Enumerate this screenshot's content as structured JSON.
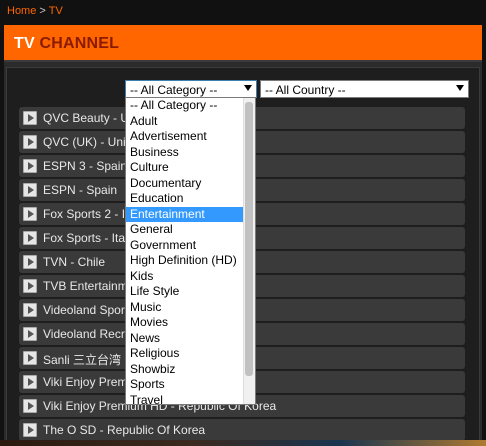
{
  "breadcrumb": {
    "home": "Home",
    "separator": ">",
    "current": "TV"
  },
  "header": {
    "title_part1": "TV",
    "title_part2": "CHANNEL"
  },
  "filters": {
    "category_selected": "-- All Category --",
    "country_selected": "-- All Country --"
  },
  "category_options": [
    "-- All Category --",
    "Adult",
    "Advertisement",
    "Business",
    "Culture",
    "Documentary",
    "Education",
    "Entertainment",
    "General",
    "Government",
    "High Definition (HD)",
    "Kids",
    "Life Style",
    "Music",
    "Movies",
    "News",
    "Religious",
    "Showbiz",
    "Sports",
    "Travel"
  ],
  "highlighted_option": "Entertainment",
  "channels": [
    "QVC Beauty - U",
    "QVC (UK) - Uni",
    "ESPN 3 - Spain",
    "ESPN - Spain",
    "Fox Sports 2 - I",
    "Fox Sports - Ita",
    "TVN - Chile",
    "TVB Entertainm                                    ovince Of China",
    "Videoland Spor                                    rovince Of China",
    "Videoland Recr                                    n Province Of China",
    "Sanli 三立台湾                                   ina",
    "Viki Enjoy Prem                                  orea",
    "Viki Enjoy Premium HD - Republic Of Korea",
    "The O SD - Republic Of Korea"
  ],
  "colors": {
    "accent": "#ff6600",
    "title_dark": "#8a1a00",
    "highlight": "#3399ff"
  }
}
